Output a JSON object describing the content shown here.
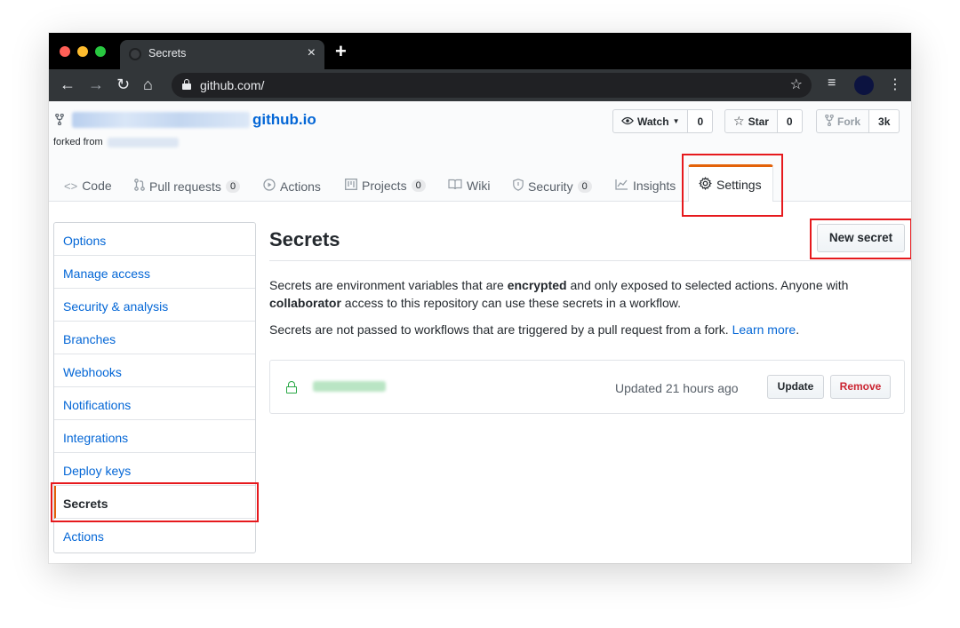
{
  "browser": {
    "tab_title": "Secrets",
    "tab_close": "×",
    "new_tab": "+",
    "url": "github.com/",
    "back": "←",
    "forward": "→",
    "reload": "↻",
    "home": "⌂",
    "bookmark_star": "☆",
    "media_icon": "≡",
    "menu_icon": "⋮"
  },
  "repo": {
    "name": "github.io",
    "forked_from_label": "forked from",
    "watch_label": "Watch",
    "watch_count": "0",
    "star_label": "Star",
    "star_count": "0",
    "fork_label": "Fork",
    "fork_count": "3k"
  },
  "nav": {
    "code": "Code",
    "pull_requests": "Pull requests",
    "pull_requests_count": "0",
    "actions": "Actions",
    "projects": "Projects",
    "projects_count": "0",
    "wiki": "Wiki",
    "security": "Security",
    "security_count": "0",
    "insights": "Insights",
    "settings": "Settings"
  },
  "sidebar": {
    "items": [
      {
        "label": "Options"
      },
      {
        "label": "Manage access"
      },
      {
        "label": "Security & analysis"
      },
      {
        "label": "Branches"
      },
      {
        "label": "Webhooks"
      },
      {
        "label": "Notifications"
      },
      {
        "label": "Integrations"
      },
      {
        "label": "Deploy keys"
      },
      {
        "label": "Secrets"
      },
      {
        "label": "Actions"
      }
    ]
  },
  "main": {
    "title": "Secrets",
    "new_secret": "New secret",
    "desc1_a": "Secrets are environment variables that are ",
    "desc1_b": "encrypted",
    "desc1_c": " and only exposed to selected actions. Anyone with ",
    "desc1_d": "collaborator",
    "desc1_e": " access to this repository can use these secrets in a workflow.",
    "desc2": "Secrets are not passed to workflows that are triggered by a pull request from a fork. ",
    "learn_more": "Learn more",
    "period": ".",
    "secret_updated": "Updated 21 hours ago",
    "update": "Update",
    "remove": "Remove"
  },
  "colors": {
    "accent_orange": "#e36209",
    "link_blue": "#0366d6",
    "highlight_red": "#e6191d",
    "remove_red": "#cb2431",
    "lock_green": "#28a745"
  }
}
